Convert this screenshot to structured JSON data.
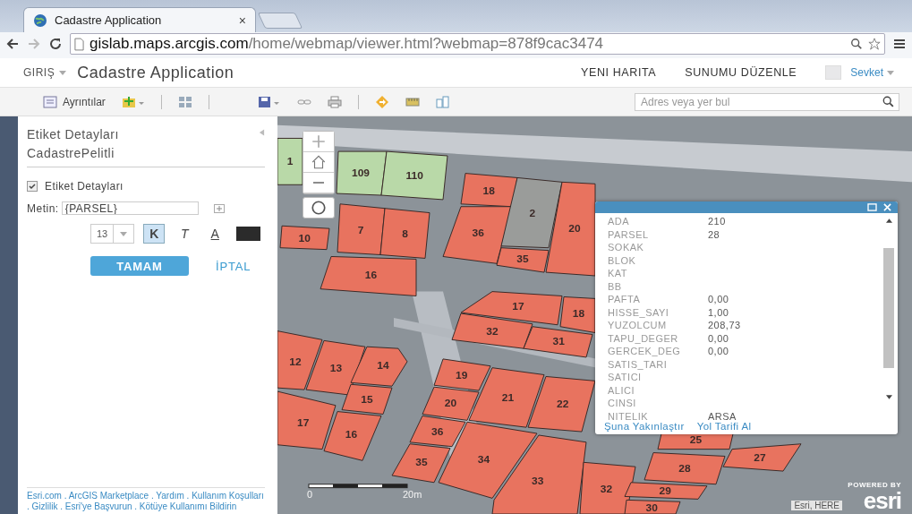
{
  "browser": {
    "tab_title": "Cadastre Application",
    "tab_close": "×",
    "url_host": "gislab.maps.arcgis.com",
    "url_path": "/home/webmap/viewer.html?webmap=878f9cac3474"
  },
  "header": {
    "home_menu": "GIRIŞ",
    "title": "Cadastre Application",
    "nav": [
      "YENI HARITA",
      "SUNUMU DÜZENLE"
    ],
    "user": "Sevket"
  },
  "toolbar": {
    "details": "Ayrıntılar",
    "search": {
      "placeholder": "Adres veya yer bul"
    }
  },
  "panel": {
    "title": "Etiket Detayları",
    "subtitle": "CadastrePelitli",
    "checkbox": {
      "label": "Etiket Detayları",
      "checked": true
    },
    "text_field": {
      "label": "Metin:",
      "value": "{PARSEL}"
    },
    "font_size": "13",
    "styles": [
      {
        "label": "K",
        "kind": "bold",
        "selected": true
      },
      {
        "label": "T",
        "kind": "italic",
        "selected": false
      },
      {
        "label": "A",
        "kind": "underline",
        "selected": false
      }
    ],
    "ok": "TAMAM",
    "cancel": "İPTAL",
    "footer_separator": ".",
    "footer_links": [
      "Esri.com",
      "ArcGIS Marketplace",
      "Yardım",
      "Kullanım Koşulları",
      "Gizlilik",
      "Esri'ye Başvurun",
      "Kötüye Kullanımı Bildirin"
    ]
  },
  "map": {
    "parcels": [
      {
        "label": "1",
        "color": "#b9d9a8"
      },
      {
        "label": "109",
        "color": "#b9d9a8"
      },
      {
        "label": "110",
        "color": "#b9d9a8"
      },
      {
        "label": "18",
        "color": "#e8735f"
      },
      {
        "label": "10",
        "color": "#e8735f"
      },
      {
        "label": "7",
        "color": "#e8735f"
      },
      {
        "label": "8",
        "color": "#e8735f"
      },
      {
        "label": "36",
        "color": "#e8735f"
      },
      {
        "label": "2",
        "color": "#9a9c9a"
      },
      {
        "label": "20",
        "color": "#e8735f"
      },
      {
        "label": "16",
        "color": "#e8735f"
      },
      {
        "label": "35",
        "color": "#e8735f"
      },
      {
        "label": "32",
        "color": "#e8735f"
      },
      {
        "label": "17",
        "color": "#e8735f"
      },
      {
        "label": "31",
        "color": "#e8735f"
      },
      {
        "label": "18",
        "color": "#e8735f"
      },
      {
        "label": "12",
        "color": "#e8735f"
      },
      {
        "label": "13",
        "color": "#e8735f"
      },
      {
        "label": "14",
        "color": "#e8735f"
      },
      {
        "label": "19",
        "color": "#e8735f"
      },
      {
        "label": "15",
        "color": "#e8735f"
      },
      {
        "label": "20",
        "color": "#e8735f"
      },
      {
        "label": "21",
        "color": "#e8735f"
      },
      {
        "label": "22",
        "color": "#e8735f"
      },
      {
        "label": "17",
        "color": "#e8735f"
      },
      {
        "label": "16",
        "color": "#e8735f"
      },
      {
        "label": "36",
        "color": "#e8735f"
      },
      {
        "label": "25",
        "color": "#e8735f"
      },
      {
        "label": "35",
        "color": "#e8735f"
      },
      {
        "label": "34",
        "color": "#e8735f"
      },
      {
        "label": "33",
        "color": "#e8735f"
      },
      {
        "label": "28",
        "color": "#e8735f"
      },
      {
        "label": "27",
        "color": "#e8735f"
      },
      {
        "label": "32",
        "color": "#e8735f"
      },
      {
        "label": "29",
        "color": "#e8735f"
      },
      {
        "label": "30",
        "color": "#e8735f"
      }
    ],
    "scale": [
      "0",
      "20m"
    ],
    "attribution": "Esri, HERE",
    "logo_small": "POWERED BY",
    "logo": "esri"
  },
  "popup": {
    "fields": [
      {
        "name": "ADA",
        "value": "210"
      },
      {
        "name": "PARSEL",
        "value": "28"
      },
      {
        "name": "SOKAK"
      },
      {
        "name": "BLOK"
      },
      {
        "name": "KAT"
      },
      {
        "name": "BB"
      },
      {
        "name": "PAFTA",
        "value": "0,00"
      },
      {
        "name": "HISSE_SAYI",
        "value": "1,00"
      },
      {
        "name": "YUZOLCUM",
        "value": "208,73"
      },
      {
        "name": "TAPU_DEGER",
        "value": "0,00"
      },
      {
        "name": "GERCEK_DEG",
        "value": "0,00"
      },
      {
        "name": "SATIS_TARI"
      },
      {
        "name": "SATICI"
      },
      {
        "name": "ALICI"
      },
      {
        "name": "CINSI"
      },
      {
        "name": "NITELIK",
        "value": "ARSA"
      }
    ],
    "links": [
      "Şuna Yakınlaştır",
      "Yol Tarifi Al"
    ]
  }
}
